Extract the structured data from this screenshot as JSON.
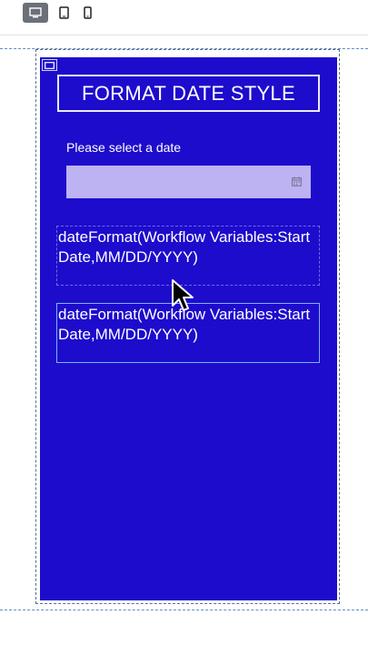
{
  "toolbar": {
    "devices": [
      {
        "name": "desktop-icon",
        "active": true
      },
      {
        "name": "tablet-icon",
        "active": false
      },
      {
        "name": "mobile-icon",
        "active": false
      }
    ]
  },
  "form": {
    "title": "FORMAT DATE STYLE",
    "date_label": "Please select a date",
    "date_value": "",
    "text_blocks": [
      "dateFormat(Workflow Variables:Start Date,MM/DD/YYYY)",
      "dateFormat(Workflow Variables:Start Date,MM/DD/YYYY)"
    ]
  },
  "colors": {
    "canvas_bg": "#1d0ccc",
    "input_bg": "#bdb2f2",
    "active_device": "#6b7079"
  }
}
